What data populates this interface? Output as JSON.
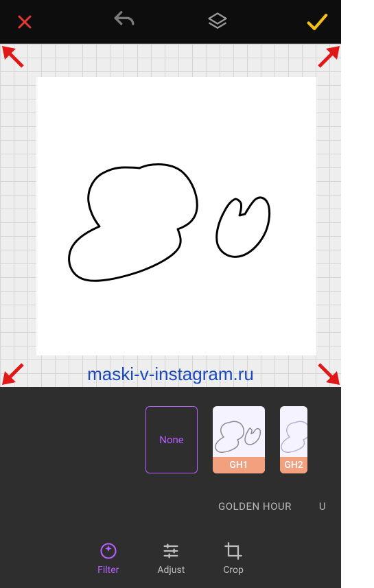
{
  "toolbar": {
    "close": "Close",
    "undo": "Undo",
    "layers": "Layers",
    "accept": "Accept"
  },
  "crop": {
    "handles": [
      "tl",
      "tr",
      "bl",
      "br"
    ]
  },
  "watermark": "maski-v-instagram.ru",
  "filters": {
    "none_label": "None",
    "items": [
      {
        "id": "gh1",
        "label": "GH1"
      },
      {
        "id": "gh2",
        "label": "GH2"
      }
    ],
    "categories": [
      {
        "id": "golden-hour",
        "label": "GOLDEN HOUR"
      },
      {
        "id": "urban",
        "label": "U"
      }
    ]
  },
  "tools": {
    "filter": "Filter",
    "adjust": "Adjust",
    "crop": "Crop"
  },
  "colors": {
    "accent": "#b760ff",
    "confirm": "#f5c116",
    "close": "#e23b2e",
    "caption": "#f3a07e"
  }
}
